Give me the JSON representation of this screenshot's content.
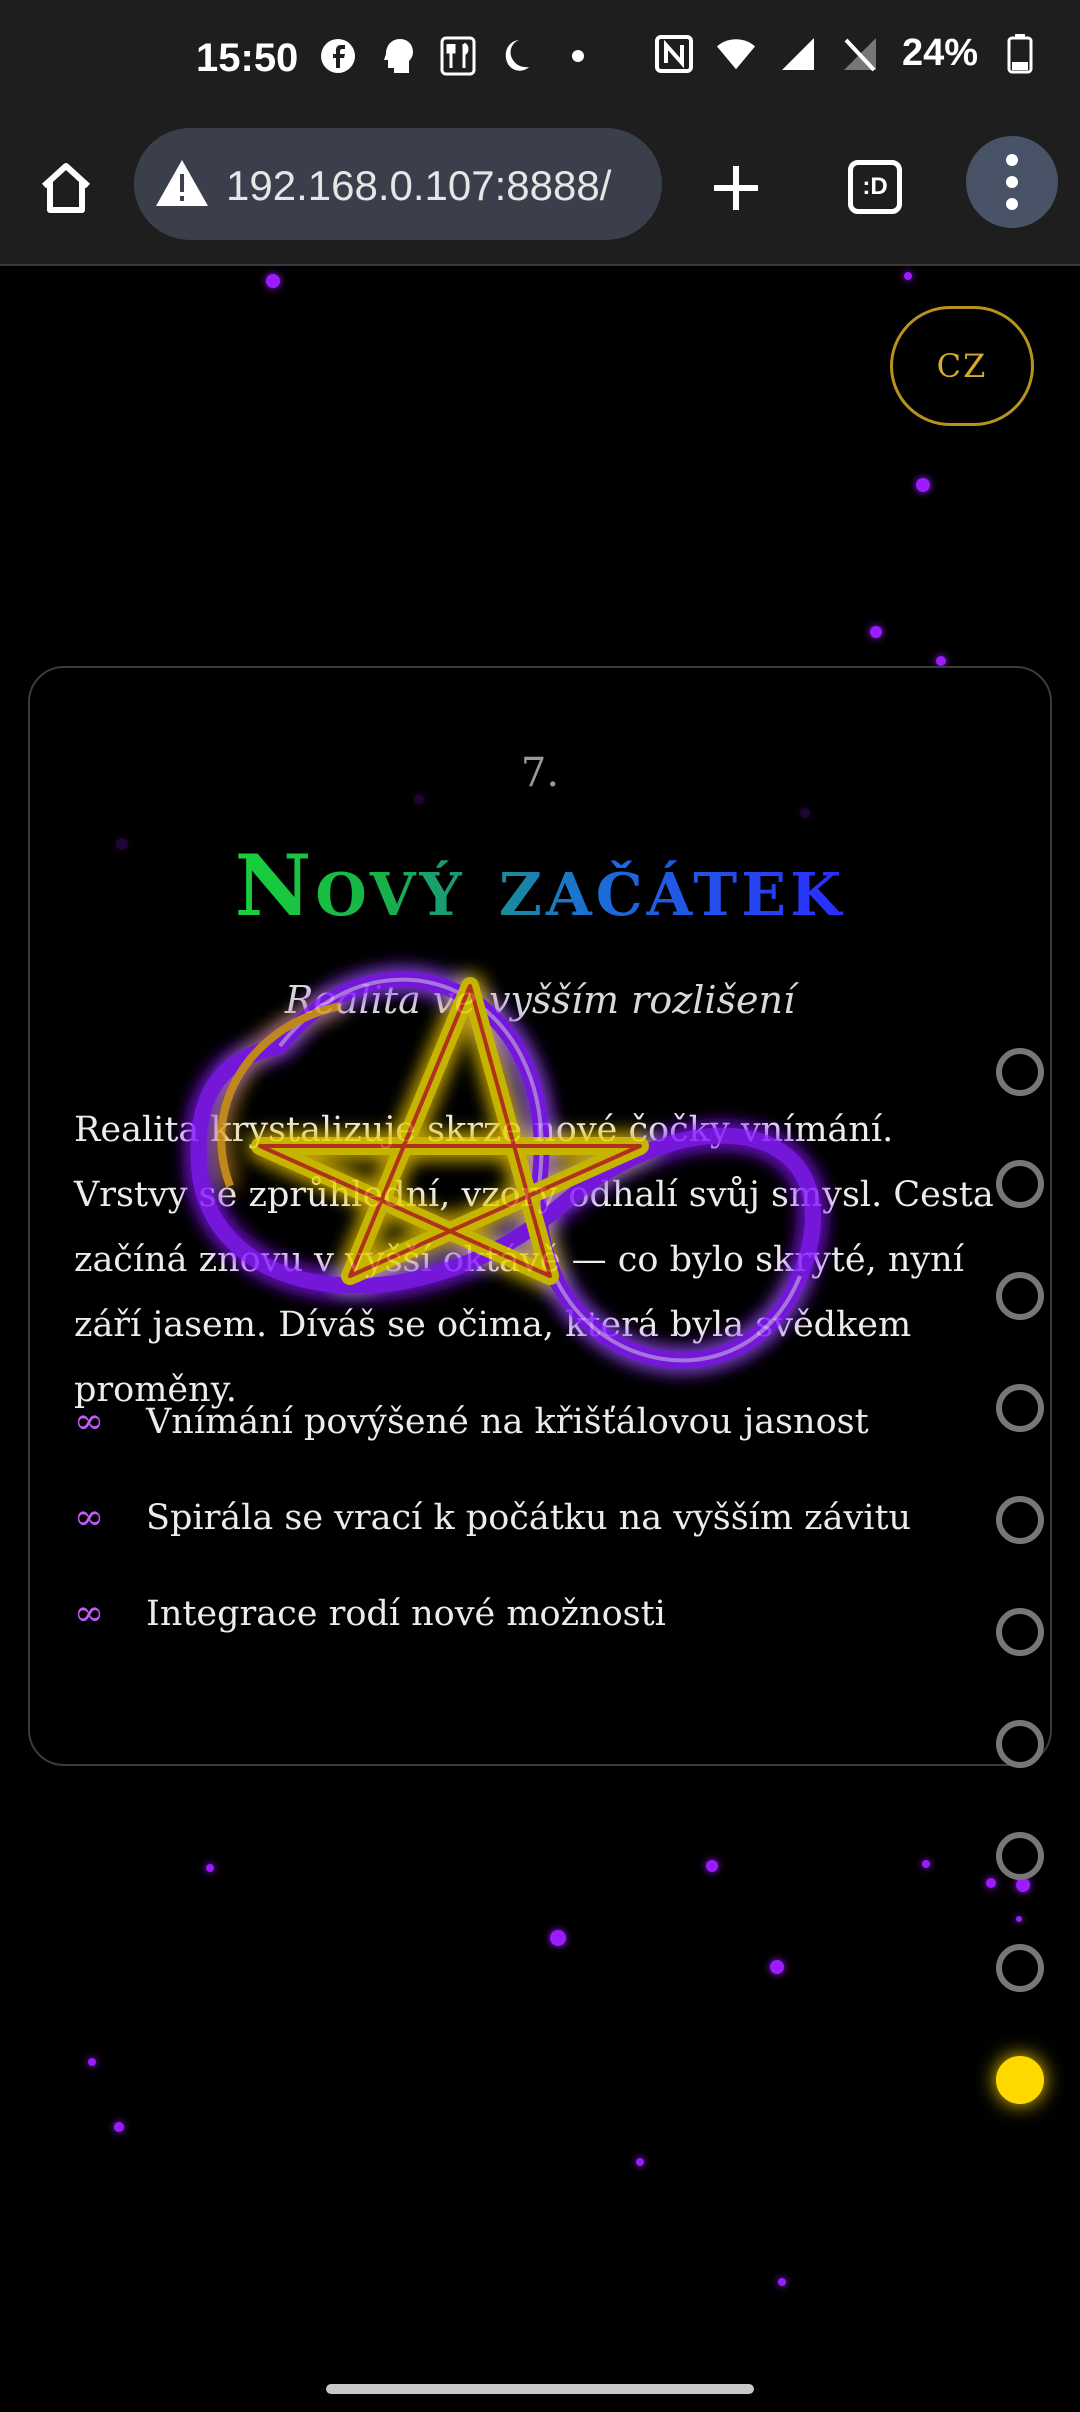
{
  "status_bar": {
    "time": "15:50",
    "left_icons": [
      "facebook-icon",
      "head-icon",
      "restaurant-icon",
      "moon-icon",
      "dot-icon"
    ],
    "right_icons": [
      "nfc-icon",
      "wifi-icon",
      "cell-signal-icon",
      "no-signal-icon",
      "battery-icon"
    ],
    "battery": "24%"
  },
  "browser": {
    "url": "192.168.0.107:8888/",
    "tab_count_label": ":D",
    "icons": [
      "home-icon",
      "warning-icon",
      "plus-icon",
      "tabs-icon",
      "more-vert-icon"
    ]
  },
  "page": {
    "lang_button": "CZ",
    "card": {
      "number": "7.",
      "title": "Nový začátek",
      "subtitle": "Realita ve vyšším rozlišení",
      "body": "Realita krystalizuje skrze nové čočky vnímání. Vrstvy se zprůhlední, vzory odhalí svůj smysl. Cesta začíná znovu v vyšší oktávě — co bylo skryté, nyní září jasem. Díváš se očima, která byla svědkem proměny.",
      "list_marker": "∞",
      "list": [
        "Vnímání povýšené na křišťálovou jasnost",
        "Spirála se vrací k počátku na vyšším závitu",
        "Integrace rodí nové možnosti"
      ]
    },
    "nav_dots": {
      "count": 10,
      "active_index": 9
    },
    "colors": {
      "accent_gold": "#d6ab2c",
      "particle_purple": "#9c1cff",
      "active_dot": "#ffd800"
    }
  }
}
